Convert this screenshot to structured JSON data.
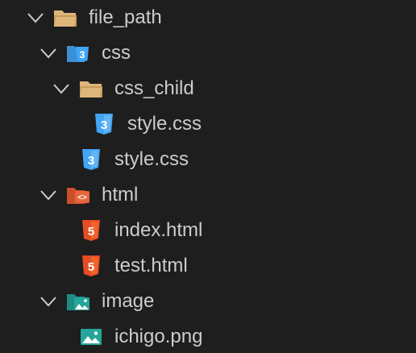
{
  "explorer": {
    "items": [
      {
        "label": "file_path",
        "kind": "folder",
        "expanded": true,
        "icon": "folder-open-icon"
      },
      {
        "label": "css",
        "kind": "folder",
        "expanded": true,
        "icon": "css-folder-icon"
      },
      {
        "label": "css_child",
        "kind": "folder",
        "expanded": true,
        "icon": "folder-open-icon"
      },
      {
        "label": "style.css",
        "kind": "file",
        "icon": "css3-file-icon"
      },
      {
        "label": "style.css",
        "kind": "file",
        "icon": "css3-file-icon"
      },
      {
        "label": "html",
        "kind": "folder",
        "expanded": true,
        "icon": "html-folder-icon"
      },
      {
        "label": "index.html",
        "kind": "file",
        "icon": "html5-file-icon"
      },
      {
        "label": "test.html",
        "kind": "file",
        "icon": "html5-file-icon"
      },
      {
        "label": "image",
        "kind": "folder",
        "expanded": true,
        "icon": "image-folder-icon"
      },
      {
        "label": "ichigo.png",
        "kind": "file",
        "icon": "image-file-icon"
      }
    ]
  },
  "colors": {
    "background": "#1e1e1e",
    "text": "#cccccc",
    "chevron": "#cccccc",
    "folder": "#dcb67a",
    "css": "#42a5f5",
    "html": "#e44d26",
    "html_folder": "#e8643c",
    "image": "#26a69a"
  }
}
